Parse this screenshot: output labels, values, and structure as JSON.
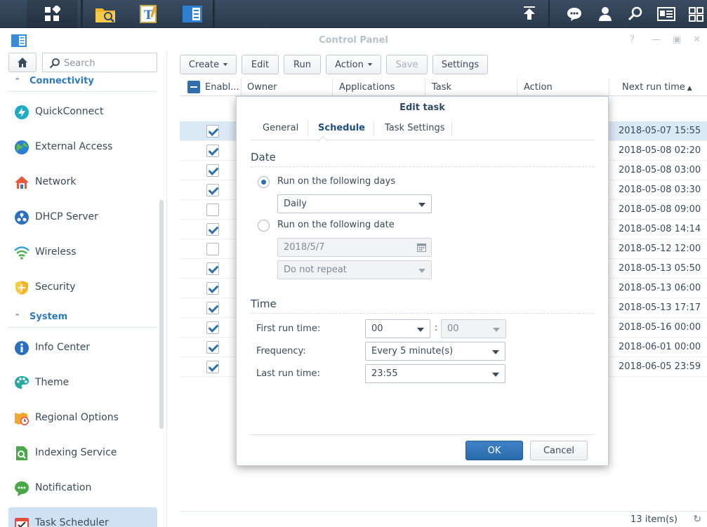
{
  "window": {
    "title": "Control Panel"
  },
  "sidebar": {
    "search_placeholder": "Search",
    "sections": [
      {
        "label": "Connectivity",
        "items": [
          {
            "label": "QuickConnect",
            "icon": "quickconnect-icon"
          },
          {
            "label": "External Access",
            "icon": "globe-icon"
          },
          {
            "label": "Network",
            "icon": "house-icon"
          },
          {
            "label": "DHCP Server",
            "icon": "dhcp-icon"
          },
          {
            "label": "Wireless",
            "icon": "wifi-icon"
          },
          {
            "label": "Security",
            "icon": "shield-icon"
          }
        ]
      },
      {
        "label": "System",
        "items": [
          {
            "label": "Info Center",
            "icon": "info-icon"
          },
          {
            "label": "Theme",
            "icon": "palette-icon"
          },
          {
            "label": "Regional Options",
            "icon": "clock-map-icon"
          },
          {
            "label": "Indexing Service",
            "icon": "indexing-icon"
          },
          {
            "label": "Notification",
            "icon": "chat-icon"
          },
          {
            "label": "Task Scheduler",
            "icon": "calendar-check-icon"
          }
        ]
      }
    ]
  },
  "toolbar": {
    "create": "Create",
    "edit": "Edit",
    "run": "Run",
    "action": "Action",
    "save": "Save",
    "settings": "Settings"
  },
  "grid": {
    "columns": [
      "Enabl...",
      "Owner",
      "Applications",
      "Task",
      "Action",
      "Next run time"
    ],
    "rows": [
      {
        "enabled": true,
        "next_run": "2018-05-07 15:55"
      },
      {
        "enabled": true,
        "next_run": "2018-05-08 02:20"
      },
      {
        "enabled": true,
        "next_run": "2018-05-08 03:00"
      },
      {
        "enabled": true,
        "next_run": "2018-05-08 03:30"
      },
      {
        "enabled": false,
        "next_run": "2018-05-08 09:00"
      },
      {
        "enabled": true,
        "next_run": "2018-05-08 14:14"
      },
      {
        "enabled": false,
        "next_run": "2018-05-12 12:00"
      },
      {
        "enabled": true,
        "next_run": "2018-05-13 05:50"
      },
      {
        "enabled": true,
        "next_run": "2018-05-13 06:00"
      },
      {
        "enabled": true,
        "next_run": "2018-05-13 17:17"
      },
      {
        "enabled": true,
        "next_run": "2018-05-16 00:00"
      },
      {
        "enabled": true,
        "next_run": "2018-06-01 00:00"
      },
      {
        "enabled": true,
        "next_run": "2018-06-05 23:59"
      }
    ],
    "item_count": "13 item(s)"
  },
  "dialog": {
    "title": "Edit task",
    "tabs": [
      "General",
      "Schedule",
      "Task Settings"
    ],
    "date_group": "Date",
    "radio_days": "Run on the following days",
    "days_value": "Daily",
    "radio_date": "Run on the following date",
    "date_value": "2018/5/7",
    "repeat_value": "Do not repeat",
    "time_group": "Time",
    "first_run_label": "First run time:",
    "first_run_hour": "00",
    "first_run_minute": "00",
    "frequency_label": "Frequency:",
    "frequency_value": "Every 5 minute(s)",
    "last_run_label": "Last run time:",
    "last_run_value": "23:55",
    "ok": "OK",
    "cancel": "Cancel"
  },
  "colors": {
    "accent": "#2f6eaa",
    "taskbar": "#34475b",
    "selected_row": "#dbe8f5"
  }
}
